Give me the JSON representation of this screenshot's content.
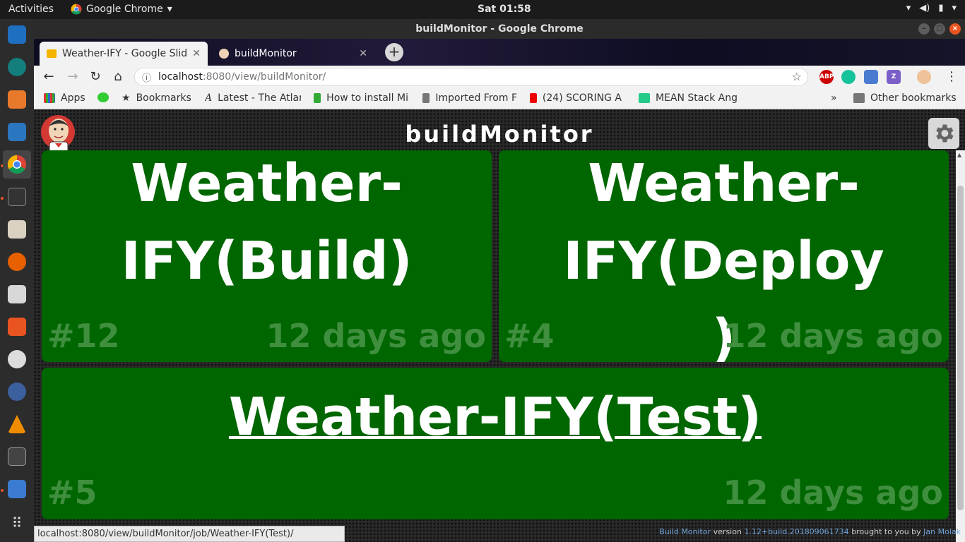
{
  "topbar": {
    "activities": "Activities",
    "app_name": "Google Chrome",
    "clock": "Sat 01:58"
  },
  "window": {
    "title": "buildMonitor - Google Chrome"
  },
  "tabs": [
    {
      "label": "Weather-IFY - Google Slid"
    },
    {
      "label": "buildMonitor"
    }
  ],
  "toolbar": {
    "url_host": "localhost",
    "url_path": ":8080/view/buildMonitor/"
  },
  "extensions": {
    "abp": "ABP",
    "z": "Z"
  },
  "bookmarks": {
    "items": [
      {
        "label": "Apps"
      },
      {
        "label": "Bookmarks"
      },
      {
        "label": "Latest - The Atlar"
      },
      {
        "label": "How to install Mi"
      },
      {
        "label": "Imported From F"
      },
      {
        "label": "(24) SCORING A"
      },
      {
        "label": "MEAN Stack Ang"
      }
    ],
    "overflow": "»",
    "other": "Other bookmarks"
  },
  "page": {
    "title": "buildMonitor"
  },
  "jobs": [
    {
      "name": "Weather-IFY(Build)",
      "build": "#12",
      "time": "12 days ago"
    },
    {
      "name": "Weather-IFY(Deploy)",
      "build": "#4",
      "time": "12 days ago"
    },
    {
      "name": "Weather-IFY(Test)",
      "build": "#5",
      "time": "12 days ago"
    }
  ],
  "statusbar": {
    "url": "localhost:8080/view/buildMonitor/job/Weather-IFY(Test)/"
  },
  "footer": {
    "product": "Build Monitor",
    "version_label": "version",
    "version": "1.12+build.201809061734",
    "brought": "brought to you by",
    "author": "Jan Molak"
  },
  "colors": {
    "job_success": "#006600",
    "ubuntu_accent": "#e95420"
  }
}
